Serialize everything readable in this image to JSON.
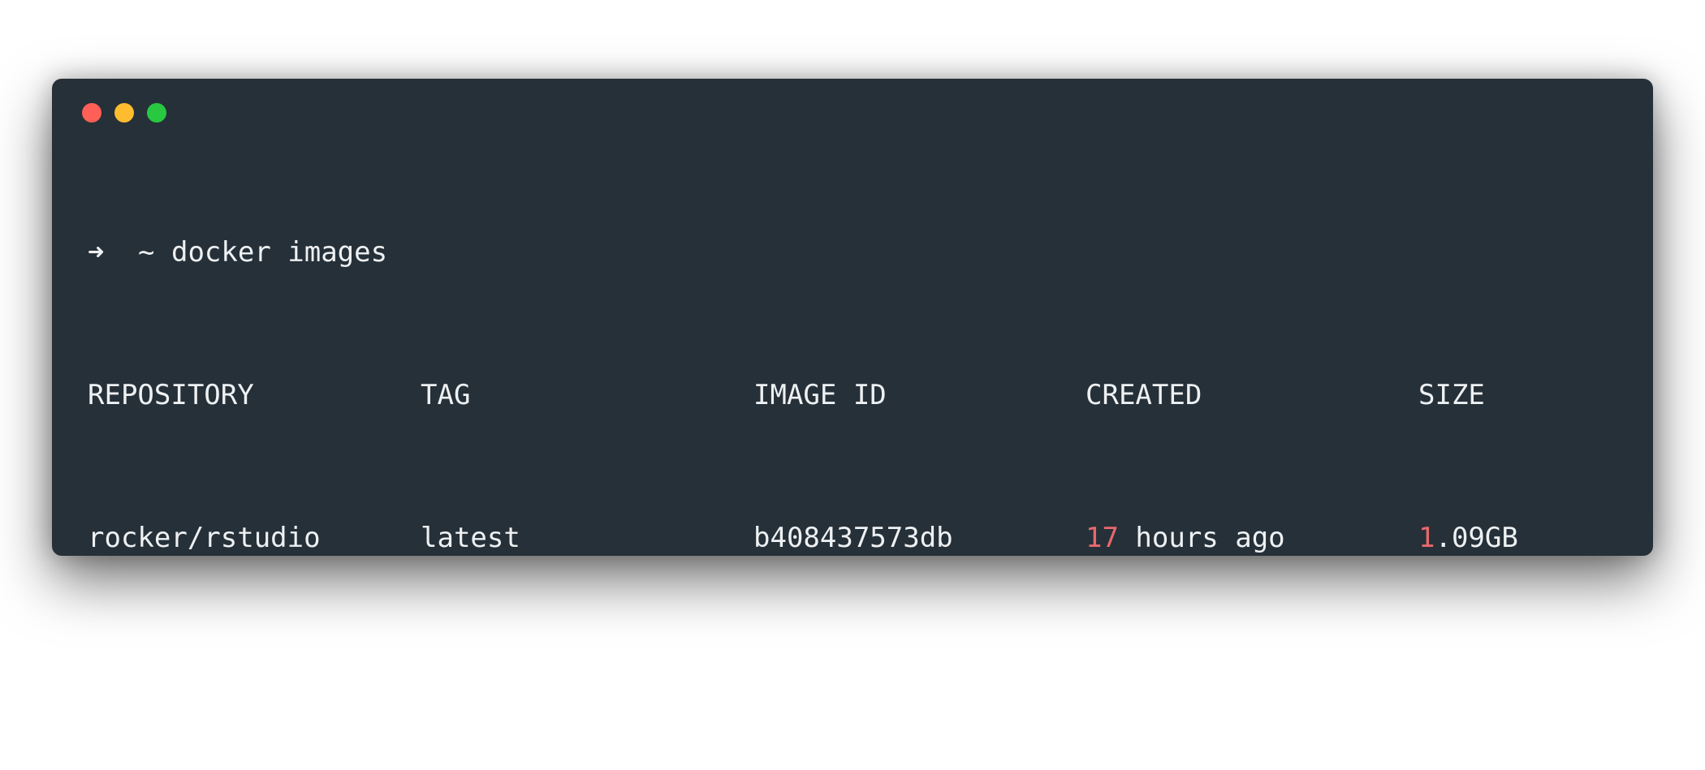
{
  "window": {
    "buttons": [
      {
        "name": "close",
        "color": "#fe5f57"
      },
      {
        "name": "minimize",
        "color": "#febc2e"
      },
      {
        "name": "maximize",
        "color": "#28c840"
      }
    ]
  },
  "terminal": {
    "prompt_symbol": "➜",
    "cwd": "~",
    "command": "docker images",
    "highlight_color": "#e8686d",
    "headers": [
      "REPOSITORY",
      "TAG",
      "IMAGE ID",
      "CREATED",
      "SIZE"
    ],
    "rows": [
      {
        "repository": "rocker/rstudio",
        "tag": "latest",
        "image_id": "b408437573db",
        "created_num": "17",
        "created_rest": " hours ago",
        "size_num": "1",
        "size_rest": ".09GB"
      }
    ]
  }
}
